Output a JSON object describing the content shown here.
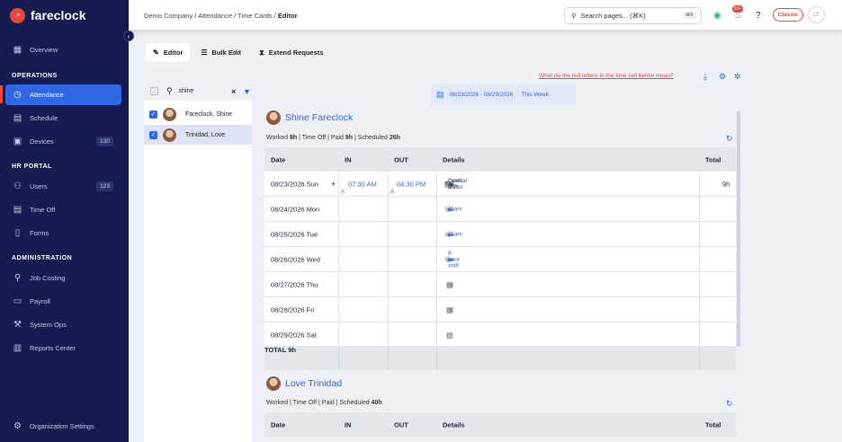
{
  "brand": {
    "name": "fareclock"
  },
  "sidebar": {
    "overview": "Overview",
    "sections": {
      "operations": "OPERATIONS",
      "hr": "HR PORTAL",
      "admin": "ADMINISTRATION"
    },
    "items": {
      "attendance": "Attendance",
      "schedule": "Schedule",
      "devices": "Devices",
      "users": "Users",
      "timeoff": "Time Off",
      "forms": "Forms",
      "jobcosting": "Job Costing",
      "payroll": "Payroll",
      "systemops": "System Ops",
      "reports": "Reports Center",
      "org": "Organization Settings"
    },
    "badges": {
      "devices": "130",
      "users": "123"
    }
  },
  "topbar": {
    "crumb_company": "Demo Company",
    "crumb_sep": "/",
    "crumb_attendance": "Attendance",
    "crumb_timecards": "Time Cards",
    "crumb_current": "Editor",
    "search_placeholder": "Search pages... (⌘K)",
    "kbd": "⌘K",
    "notifications": "52+",
    "classic": "Classic",
    "avatar": "LT"
  },
  "tabs": {
    "editor": "Editor",
    "bulk": "Bulk Edit",
    "extend": "Extend Requests"
  },
  "employee_filter": {
    "query": "shine"
  },
  "employees": [
    {
      "name": "Fareclock, Shine"
    },
    {
      "name": "Trinidad, Love"
    }
  ],
  "help_link": "What do the red letters in the time cell below mean?",
  "date_range": {
    "text": "08/23/2026 - 08/29/2026",
    "label": "This Week"
  },
  "columns": {
    "date": "Date",
    "in": "IN",
    "out": "OUT",
    "details": "Details",
    "total": "Total"
  },
  "card1": {
    "name": "Shine Fareclock",
    "summary": {
      "worked_label": "Worked",
      "worked": "9h",
      "timeoff": "Time Off",
      "paid_label": "Paid",
      "paid": "9h",
      "scheduled_label": "Scheduled",
      "scheduled": "26h",
      "sep": "|"
    },
    "rows": [
      {
        "date": "08/23/2026 Sun",
        "in": "07:30 AM",
        "out": "04:30 PM",
        "location": "Central Office",
        "shift": "Open shift",
        "total": "9h"
      },
      {
        "date": "08/24/2026 Mon",
        "chip": "11am"
      },
      {
        "date": "08/25/2026 Tue",
        "chip": "11am"
      },
      {
        "date": "08/26/2026 Wed",
        "chip": "8 hour shift"
      },
      {
        "date": "08/27/2026 Thu"
      },
      {
        "date": "08/28/2026 Fri"
      },
      {
        "date": "08/29/2026 Sat"
      }
    ],
    "total_label": "TOTAL",
    "total": "9h"
  },
  "card2": {
    "name": "Love Trinidad",
    "summary": {
      "worked_label": "Worked",
      "timeoff": "Time Off",
      "paid_label": "Paid",
      "scheduled_label": "Scheduled",
      "scheduled": "40h",
      "sep": "|"
    }
  },
  "red_marker": "A",
  "plus": "+",
  "colors": {
    "sidebar": "#161c4f",
    "accent": "#2f67e6",
    "brand_red": "#e9463d"
  }
}
